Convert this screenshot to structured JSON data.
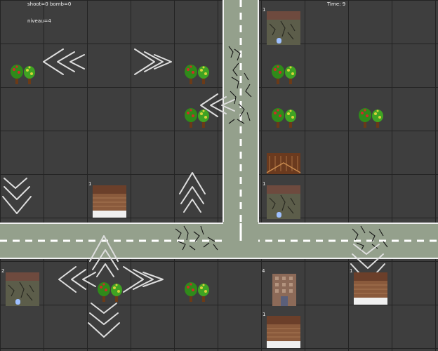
{
  "hud": {
    "shoot_label": "shoot=",
    "shoot": "0",
    "bomb_label": "bomb=",
    "bomb": "0",
    "level_label": "niveau=",
    "level": "4",
    "time_label": "Time:",
    "time": "9"
  },
  "buildings": [
    {
      "kind": "stone-house",
      "count": "1"
    },
    {
      "kind": "stone-house",
      "count": "1"
    },
    {
      "kind": "wood-house",
      "count": "1"
    },
    {
      "kind": "stone-house",
      "count": "2"
    },
    {
      "kind": "tower",
      "count": "4"
    },
    {
      "kind": "wood-house",
      "count": "1"
    },
    {
      "kind": "wood-house",
      "count": "1"
    }
  ],
  "colors": {
    "ground": "#3e3e3e",
    "grid": "#232323",
    "road": "#94a08c",
    "road_edge": "#f0f0f0",
    "marking": "#ffffff",
    "crack": "#151515",
    "chevron": "#dedede"
  }
}
